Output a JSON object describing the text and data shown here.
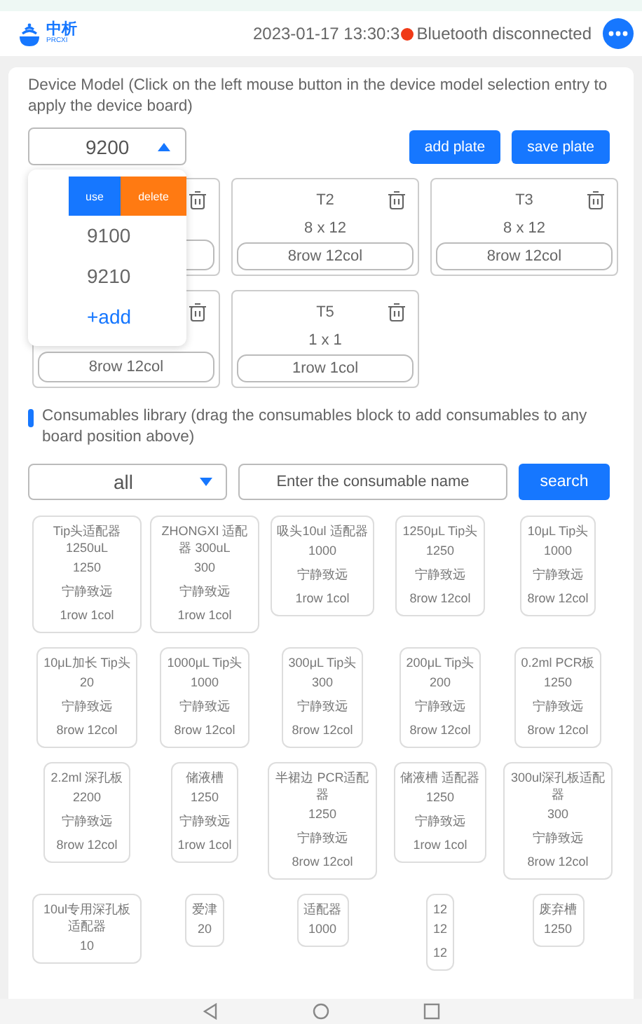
{
  "header": {
    "brand": "中析",
    "brand_sub": "PRCXI",
    "time": "2023-01-17 13:30:3",
    "bluetooth": {
      "connected": false,
      "label": "Bluetooth disconnected"
    }
  },
  "device": {
    "hint": "Device Model (Click on the left mouse button in the device model selection entry to apply the device board)",
    "model": "9200",
    "expanded": true,
    "buttons": [
      "add plate",
      "save plate"
    ]
  },
  "dropdown": {
    "actions": [
      {
        "label": "use",
        "kind": "use"
      },
      {
        "label": "delete",
        "kind": "delete"
      }
    ],
    "options": [
      {
        "label": "9100",
        "kind": "option"
      },
      {
        "label": "9210",
        "kind": "option"
      },
      {
        "label": "+add",
        "kind": "add"
      }
    ]
  },
  "plates": [
    {
      "kind": "plate"
    },
    {
      "kind": "plate",
      "name": "T2",
      "size": "8 x 12",
      "layout": "8row 12col"
    },
    {
      "kind": "plate",
      "name": "T3",
      "size": "8 x 12",
      "layout": "8row 12col"
    },
    {
      "kind": "plate",
      "layout": "8row 12col"
    },
    {
      "kind": "plate",
      "name": "T5",
      "size": "1 x 1",
      "layout": "1row 1col"
    }
  ],
  "library": {
    "hint": "Consumables library (drag the consumables block to add consumables to any board position above)",
    "category": "all",
    "search_placeholder": "Enter the consumable name",
    "search_button": "search"
  },
  "consumables": [
    {
      "name": "Tip头适配器 1250uL",
      "lines": [
        "1250",
        "宁静致远",
        "1row 1col"
      ]
    },
    {
      "name": "ZHONGXI 适配器 300uL",
      "lines": [
        "300",
        "宁静致远",
        "1row 1col"
      ]
    },
    {
      "name": "吸头10ul 适配器",
      "lines": [
        "1000",
        "宁静致远",
        "1row 1col"
      ]
    },
    {
      "name": "1250μL Tip头",
      "lines": [
        "1250",
        "宁静致远",
        "8row 12col"
      ]
    },
    {
      "name": "10μL Tip头",
      "lines": [
        "1000",
        "宁静致远",
        "8row 12col"
      ]
    },
    {
      "name": "10μL加长 Tip头",
      "lines": [
        "20",
        "宁静致远",
        "8row 12col"
      ]
    },
    {
      "name": "1000μL Tip头",
      "lines": [
        "1000",
        "宁静致远",
        "8row 12col"
      ]
    },
    {
      "name": "300μL Tip头",
      "lines": [
        "300",
        "宁静致远",
        "8row 12col"
      ]
    },
    {
      "name": "200μL Tip头",
      "lines": [
        "200",
        "宁静致远",
        "8row 12col"
      ]
    },
    {
      "name": "0.2ml PCR板",
      "lines": [
        "1250",
        "宁静致远",
        "8row 12col"
      ]
    },
    {
      "name": "2.2ml 深孔板",
      "lines": [
        "2200",
        "宁静致远",
        "8row 12col"
      ]
    },
    {
      "name": "储液槽",
      "lines": [
        "1250",
        "宁静致远",
        "1row 1col"
      ]
    },
    {
      "name": "半裙边 PCR适配器",
      "lines": [
        "1250",
        "宁静致远",
        "8row 12col"
      ]
    },
    {
      "name": "储液槽 适配器",
      "lines": [
        "1250",
        "宁静致远",
        "1row 1col"
      ]
    },
    {
      "name": "300ul深孔板适配器",
      "lines": [
        "300",
        "宁静致远",
        "8row 12col"
      ]
    },
    {
      "name": "10ul专用深孔板适配器",
      "lines": [
        "10"
      ]
    },
    {
      "name": "爱津",
      "lines": [
        "20"
      ]
    },
    {
      "name": "适配器",
      "lines": [
        "1000"
      ]
    },
    {
      "name": "12",
      "lines": [
        "12",
        "12"
      ]
    },
    {
      "name": "废弃槽",
      "lines": [
        "1250"
      ]
    }
  ]
}
